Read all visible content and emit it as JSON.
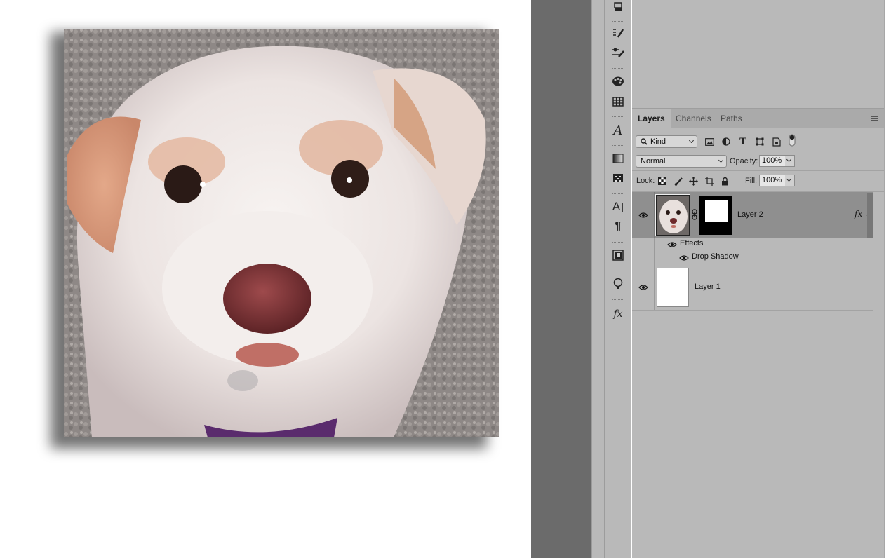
{
  "panel": {
    "tabs": [
      {
        "label": "Layers",
        "active": true
      },
      {
        "label": "Channels",
        "active": false
      },
      {
        "label": "Paths",
        "active": false
      }
    ],
    "filter": {
      "kind_label": "Kind",
      "icons": [
        "image-filter-icon",
        "adjustment-filter-icon",
        "type-filter-icon",
        "shape-filter-icon",
        "smart-object-filter-icon",
        "filter-toggle-icon"
      ]
    },
    "blend": {
      "mode": "Normal",
      "opacity_label": "Opacity:",
      "opacity_value": "100%"
    },
    "lock": {
      "label": "Lock:",
      "icons": [
        "lock-transparent-icon",
        "lock-image-icon",
        "lock-position-icon",
        "lock-artboard-icon",
        "lock-all-icon"
      ],
      "fill_label": "Fill:",
      "fill_value": "100%"
    },
    "layers": [
      {
        "name": "Layer 2",
        "selected": true,
        "visible": true,
        "has_mask": true,
        "fx": "fx"
      },
      {
        "name": "Layer 1",
        "selected": false,
        "visible": true
      }
    ],
    "effects": {
      "label": "Effects",
      "items": [
        "Drop Shadow"
      ]
    }
  },
  "toolbar": {
    "tools": [
      "3d-icon",
      "brush-presets-icon",
      "brush-settings-icon",
      "color-swatch-icon",
      "grid-icon",
      "glyphs-icon",
      "gradient-icon",
      "pattern-icon",
      "character-icon",
      "paragraph-icon",
      "libraries-icon",
      "learn-icon",
      "styles-icon"
    ]
  },
  "colors": {
    "panel_bg": "#b9b9b9",
    "gutter": "#6b6b6b",
    "selected_row": "#8f8f8f",
    "canvas_bg": "#ffffff"
  }
}
